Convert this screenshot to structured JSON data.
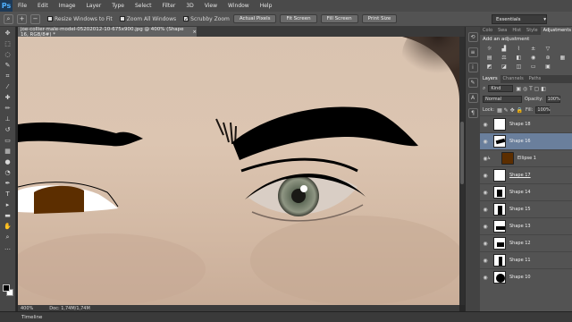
{
  "app": {
    "logo": "Ps"
  },
  "menu": [
    "File",
    "Edit",
    "Image",
    "Layer",
    "Type",
    "Select",
    "Filter",
    "3D",
    "View",
    "Window",
    "Help"
  ],
  "options": {
    "resize_windows": "Resize Windows to Fit",
    "zoom_all": "Zoom All Windows",
    "scrubby_zoom": "Scrubby Zoom",
    "actual_pixels": "Actual Pixels",
    "fit_screen": "Fit Screen",
    "fill_screen": "Fill Screen",
    "print_size": "Print Size",
    "workspace": "Essentials"
  },
  "document": {
    "tab_title": "joe-collier-male-model-05202012-10-675x900.jpg @ 400% (Shape 16, RGB/8#) *",
    "close": "×",
    "zoom": "400%",
    "doc_size": "Doc: 1,74M/1,74M"
  },
  "timeline_label": "Timeline",
  "panels": {
    "top_tabs": [
      "Colo",
      "Swa",
      "Hist",
      "Style",
      "Adjustments"
    ],
    "adjust_title": "Add an adjustment",
    "layer_tabs": [
      "Layers",
      "Channels",
      "Paths"
    ],
    "kind": "Kind",
    "blend_mode": "Normal",
    "opacity_label": "Opacity:",
    "opacity_value": "100%",
    "lock_label": "Lock:",
    "fill_label": "Fill:",
    "fill_value": "100%"
  },
  "layers": [
    {
      "name": "Shape 18"
    },
    {
      "name": "Shape 16"
    },
    {
      "name": "Ellipse 1"
    },
    {
      "name": "Shape 17"
    },
    {
      "name": "Shape 14"
    },
    {
      "name": "Shape 15"
    },
    {
      "name": "Shape 13"
    },
    {
      "name": "Shape 12"
    },
    {
      "name": "Shape 11"
    },
    {
      "name": "Shape 10"
    }
  ],
  "colors": {
    "accent": "#6a7f9c",
    "iris": "#5c2e00",
    "skin": "#d9c3b0"
  }
}
